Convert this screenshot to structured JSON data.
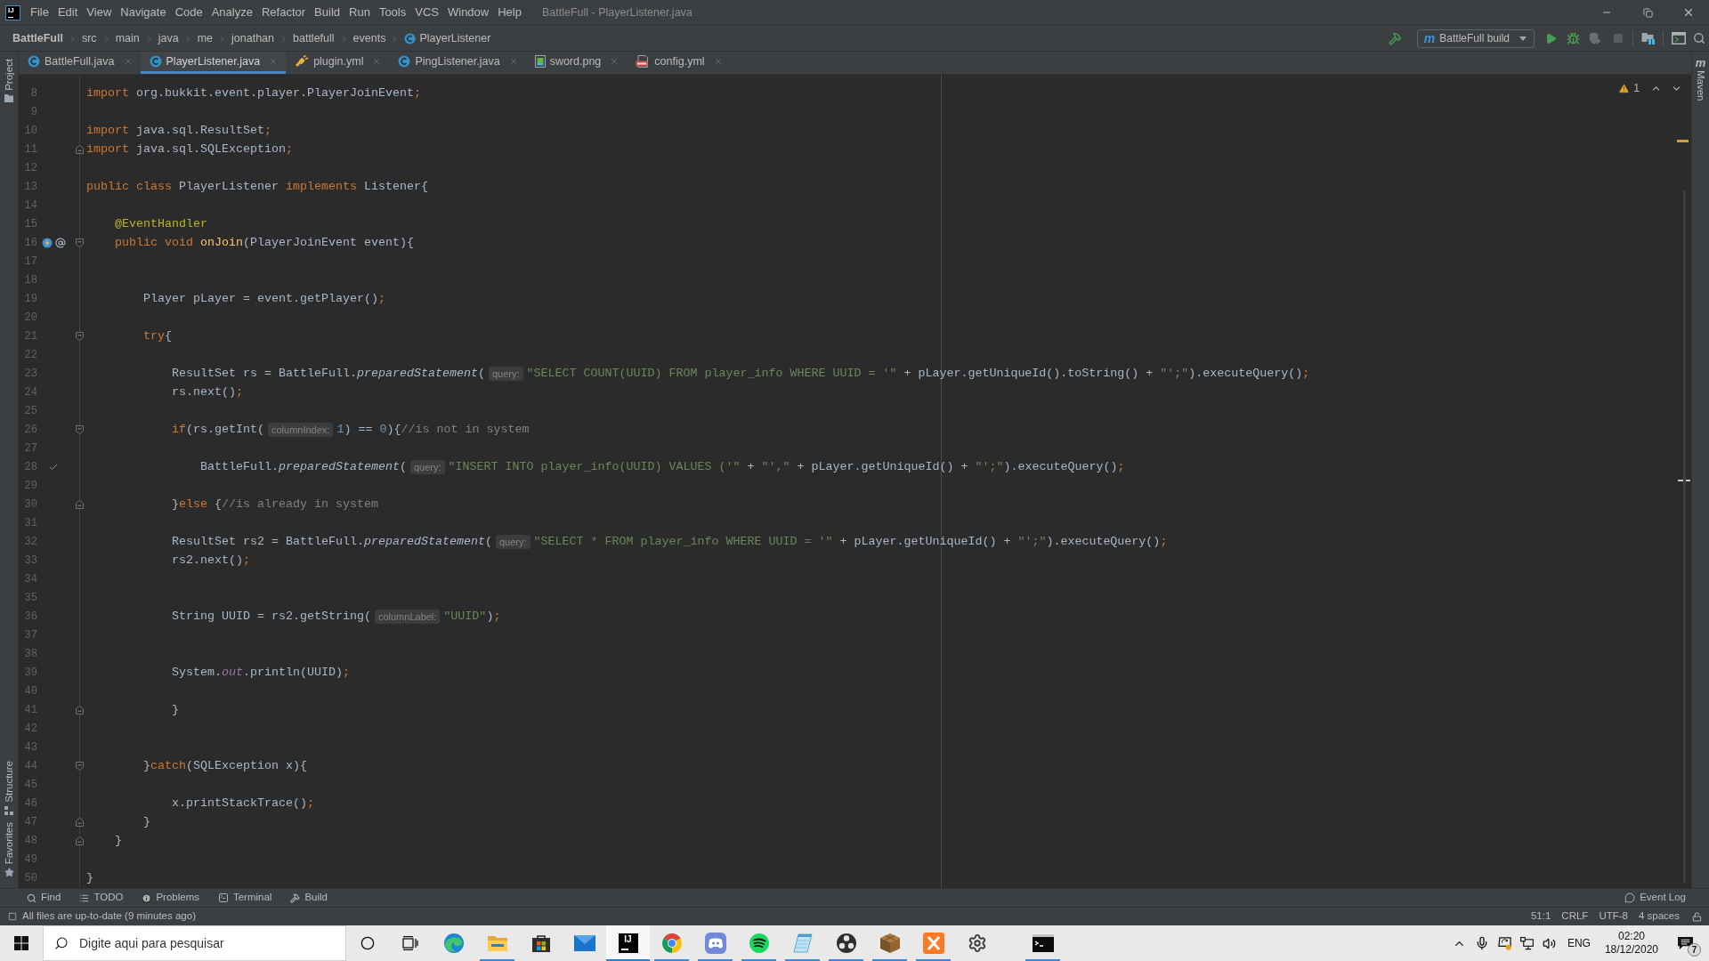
{
  "menu_bar": {
    "logo": "IJ",
    "items": [
      "File",
      "Edit",
      "View",
      "Navigate",
      "Code",
      "Analyze",
      "Refactor",
      "Build",
      "Run",
      "Tools",
      "VCS",
      "Window",
      "Help"
    ],
    "title": "BattleFull - PlayerListener.java"
  },
  "nav_bar": {
    "breadcrumbs": [
      {
        "label": "BattleFull",
        "kind": "project"
      },
      {
        "label": "src",
        "kind": "folder"
      },
      {
        "label": "main",
        "kind": "folder"
      },
      {
        "label": "java",
        "kind": "folder"
      },
      {
        "label": "me",
        "kind": "folder"
      },
      {
        "label": "jonathan",
        "kind": "folder"
      },
      {
        "label": "battlefull",
        "kind": "folder"
      },
      {
        "label": "events",
        "kind": "folder"
      },
      {
        "label": "PlayerListener",
        "kind": "class"
      }
    ],
    "run_config": {
      "glyph": "m",
      "label": "BattleFull build"
    }
  },
  "tool_strips": {
    "left": [
      {
        "label": "Project",
        "kind": "project"
      },
      {
        "label": "Structure",
        "kind": "structure"
      },
      {
        "label": "Favorites",
        "kind": "favorites"
      }
    ],
    "right": {
      "glyph": "m",
      "label": "Maven"
    }
  },
  "tabs": [
    {
      "label": "BattleFull.java",
      "kind": "class",
      "selected": false
    },
    {
      "label": "PlayerListener.java",
      "kind": "class",
      "selected": true
    },
    {
      "label": "plugin.yml",
      "kind": "plugin",
      "selected": false
    },
    {
      "label": "PingListener.java",
      "kind": "class",
      "selected": false
    },
    {
      "label": "sword.png",
      "kind": "image",
      "selected": false
    },
    {
      "label": "config.yml",
      "kind": "yaml",
      "selected": false
    }
  ],
  "editor": {
    "warnings": "1",
    "lines": [
      {
        "number": "8",
        "tokens": [
          {
            "kind": "keyword",
            "text": "import"
          },
          {
            "kind": "plain",
            "text": " org.bukkit.event.player.PlayerJoinEvent"
          },
          {
            "kind": "punct",
            "text": ";"
          }
        ]
      },
      {
        "number": "9"
      },
      {
        "number": "10",
        "tokens": [
          {
            "kind": "keyword",
            "text": "import"
          },
          {
            "kind": "plain",
            "text": " java.sql.ResultSet"
          },
          {
            "kind": "punct",
            "text": ";"
          }
        ]
      },
      {
        "number": "11",
        "fold": {
          "kind": "end"
        },
        "tokens": [
          {
            "kind": "keyword",
            "text": "import"
          },
          {
            "kind": "plain",
            "text": " java.sql.SQLException"
          },
          {
            "kind": "punct",
            "text": ";"
          }
        ]
      },
      {
        "number": "12"
      },
      {
        "number": "13",
        "tokens": [
          {
            "kind": "keyword",
            "text": "public class"
          },
          {
            "kind": "plain",
            "text": " PlayerListener "
          },
          {
            "kind": "keyword",
            "text": "implements"
          },
          {
            "kind": "plain",
            "text": " Listener{"
          }
        ]
      },
      {
        "number": "14"
      },
      {
        "number": "15",
        "tokens": [
          {
            "kind": "annotation",
            "text": "    @EventHandler"
          }
        ]
      },
      {
        "number": "16",
        "fold": {
          "kind": "start"
        },
        "gutter": [
          {
            "kind": "bolt"
          },
          {
            "kind": "at"
          }
        ],
        "tokens": [
          {
            "kind": "keyword",
            "text": "    public void "
          },
          {
            "kind": "method",
            "text": "onJoin"
          },
          {
            "kind": "plain",
            "text": "(PlayerJoinEvent event){"
          }
        ]
      },
      {
        "number": "17"
      },
      {
        "number": "18"
      },
      {
        "number": "19",
        "tokens": [
          {
            "kind": "plain",
            "text": "        Player pLayer = event.getPlayer()"
          },
          {
            "kind": "punct",
            "text": ";"
          }
        ]
      },
      {
        "number": "20"
      },
      {
        "number": "21",
        "fold": {
          "kind": "start"
        },
        "tokens": [
          {
            "kind": "keyword",
            "text": "        try"
          },
          {
            "kind": "plain",
            "text": "{"
          }
        ]
      },
      {
        "number": "22"
      },
      {
        "number": "23",
        "tokens": [
          {
            "kind": "plain",
            "text": "            ResultSet rs = BattleFull."
          },
          {
            "kind": "static",
            "text": "preparedStatement"
          },
          {
            "kind": "plain",
            "text": "("
          },
          {
            "kind": "hint",
            "text": "query:"
          },
          {
            "kind": "string",
            "text": "\"SELECT COUNT(UUID) FROM player_info WHERE UUID = '\""
          },
          {
            "kind": "plain",
            "text": " + pLayer.getUniqueId().toString() + "
          },
          {
            "kind": "string",
            "text": "\"';\""
          },
          {
            "kind": "plain",
            "text": ").executeQuery()"
          },
          {
            "kind": "punct",
            "text": ";"
          }
        ]
      },
      {
        "number": "24",
        "tokens": [
          {
            "kind": "plain",
            "text": "            rs.next()"
          },
          {
            "kind": "punct",
            "text": ";"
          }
        ]
      },
      {
        "number": "25"
      },
      {
        "number": "26",
        "fold": {
          "kind": "start"
        },
        "tokens": [
          {
            "kind": "keyword",
            "text": "            if"
          },
          {
            "kind": "plain",
            "text": "(rs.getInt("
          },
          {
            "kind": "hint",
            "text": "columnIndex:"
          },
          {
            "kind": "number",
            "text": "1"
          },
          {
            "kind": "plain",
            "text": ") == "
          },
          {
            "kind": "number",
            "text": "0"
          },
          {
            "kind": "plain",
            "text": "){"
          },
          {
            "kind": "comment",
            "text": "//is not in system"
          }
        ]
      },
      {
        "number": "27"
      },
      {
        "number": "28",
        "gutter": [
          {
            "kind": "check"
          }
        ],
        "tokens": [
          {
            "kind": "plain",
            "text": "                BattleFull."
          },
          {
            "kind": "static",
            "text": "preparedStatement"
          },
          {
            "kind": "plain",
            "text": "("
          },
          {
            "kind": "hint",
            "text": "query:"
          },
          {
            "kind": "string",
            "text": "\"INSERT INTO player_info(UUID) VALUES ('\""
          },
          {
            "kind": "plain",
            "text": " + "
          },
          {
            "kind": "string",
            "text": "\"',\""
          },
          {
            "kind": "plain",
            "text": " + pLayer.getUniqueId() + "
          },
          {
            "kind": "string",
            "text": "\"';\""
          },
          {
            "kind": "plain",
            "text": ").executeQuery()"
          },
          {
            "kind": "punct",
            "text": ";"
          }
        ]
      },
      {
        "number": "29"
      },
      {
        "number": "30",
        "fold": {
          "kind": "end"
        },
        "tokens": [
          {
            "kind": "plain",
            "text": "            }"
          },
          {
            "kind": "keyword",
            "text": "else"
          },
          {
            "kind": "plain",
            "text": " {"
          },
          {
            "kind": "comment",
            "text": "//is already in system"
          }
        ]
      },
      {
        "number": "31"
      },
      {
        "number": "32",
        "tokens": [
          {
            "kind": "plain",
            "text": "            ResultSet rs2 = BattleFull."
          },
          {
            "kind": "static",
            "text": "preparedStatement"
          },
          {
            "kind": "plain",
            "text": "("
          },
          {
            "kind": "hint",
            "text": "query:"
          },
          {
            "kind": "string",
            "text": "\"SELECT * FROM player_info WHERE UUID = '\""
          },
          {
            "kind": "plain",
            "text": " + pLayer.getUniqueId() + "
          },
          {
            "kind": "string",
            "text": "\"';\""
          },
          {
            "kind": "plain",
            "text": ").executeQuery()"
          },
          {
            "kind": "punct",
            "text": ";"
          }
        ]
      },
      {
        "number": "33",
        "tokens": [
          {
            "kind": "plain",
            "text": "            rs2.next()"
          },
          {
            "kind": "punct",
            "text": ";"
          }
        ]
      },
      {
        "number": "34"
      },
      {
        "number": "35"
      },
      {
        "number": "36",
        "tokens": [
          {
            "kind": "plain",
            "text": "            String UUID = rs2.getString("
          },
          {
            "kind": "hint",
            "text": "columnLabel:"
          },
          {
            "kind": "string",
            "text": "\"UUID\""
          },
          {
            "kind": "plain",
            "text": ")"
          },
          {
            "kind": "punct",
            "text": ";"
          }
        ]
      },
      {
        "number": "37"
      },
      {
        "number": "38"
      },
      {
        "number": "39",
        "tokens": [
          {
            "kind": "plain",
            "text": "            System."
          },
          {
            "kind": "field",
            "text": "out"
          },
          {
            "kind": "plain",
            "text": ".println(UUID)"
          },
          {
            "kind": "punct",
            "text": ";"
          }
        ]
      },
      {
        "number": "40"
      },
      {
        "number": "41",
        "fold": {
          "kind": "end"
        },
        "tokens": [
          {
            "kind": "plain",
            "text": "            }"
          }
        ]
      },
      {
        "number": "42"
      },
      {
        "number": "43"
      },
      {
        "number": "44",
        "fold": {
          "kind": "start"
        },
        "tokens": [
          {
            "kind": "plain",
            "text": "        }"
          },
          {
            "kind": "keyword",
            "text": "catch"
          },
          {
            "kind": "plain",
            "text": "(SQLException x){"
          }
        ]
      },
      {
        "number": "45"
      },
      {
        "number": "46",
        "tokens": [
          {
            "kind": "plain",
            "text": "            x.printStackTrace()"
          },
          {
            "kind": "punct",
            "text": ";"
          }
        ]
      },
      {
        "number": "47",
        "fold": {
          "kind": "end"
        },
        "tokens": [
          {
            "kind": "plain",
            "text": "        }"
          }
        ]
      },
      {
        "number": "48",
        "fold": {
          "kind": "end"
        },
        "tokens": [
          {
            "kind": "plain",
            "text": "    }"
          }
        ]
      },
      {
        "number": "49"
      },
      {
        "number": "50",
        "tokens": [
          {
            "kind": "plain",
            "text": "}"
          }
        ]
      }
    ]
  },
  "tool_windows": {
    "left": [
      {
        "label": "Find",
        "kind": "find"
      },
      {
        "label": "TODO",
        "kind": "todo"
      },
      {
        "label": "Problems",
        "kind": "problems"
      },
      {
        "label": "Terminal",
        "kind": "terminal"
      },
      {
        "label": "Build",
        "kind": "build"
      }
    ],
    "right": [
      {
        "label": "Event Log",
        "kind": "log"
      }
    ]
  },
  "status_bar": {
    "message": "All files are up-to-date (9 minutes ago)",
    "items": [
      "51:1",
      "CRLF",
      "UTF-8",
      "4 spaces"
    ]
  },
  "taskbar": {
    "search": {
      "placeholder": "Digite aqui para pesquisar"
    },
    "apps": [
      {
        "kind": "swirl",
        "running": false,
        "active": false
      },
      {
        "kind": "folder",
        "running": true,
        "active": false
      },
      {
        "kind": "bag",
        "running": false,
        "active": false
      },
      {
        "kind": "mail",
        "running": false,
        "active": false
      },
      {
        "kind": "ide",
        "logo": "IJ",
        "running": true,
        "active": true
      },
      {
        "kind": "ring",
        "running": true,
        "active": false
      },
      {
        "kind": "controller",
        "running": true,
        "active": false
      },
      {
        "kind": "waves",
        "running": true,
        "active": false
      },
      {
        "kind": "notepad",
        "running": true,
        "active": false
      },
      {
        "kind": "aperture",
        "running": true,
        "active": false
      },
      {
        "kind": "crate",
        "running": true,
        "active": false
      },
      {
        "kind": "xlogo",
        "running": true,
        "active": false
      },
      {
        "kind": "gear",
        "running": false,
        "active": false
      },
      {
        "kind": "console",
        "running": true,
        "active": false
      }
    ],
    "tray": {
      "language": "ENG",
      "time": "02:20",
      "date": "18/12/2020",
      "notifications": "7"
    }
  }
}
